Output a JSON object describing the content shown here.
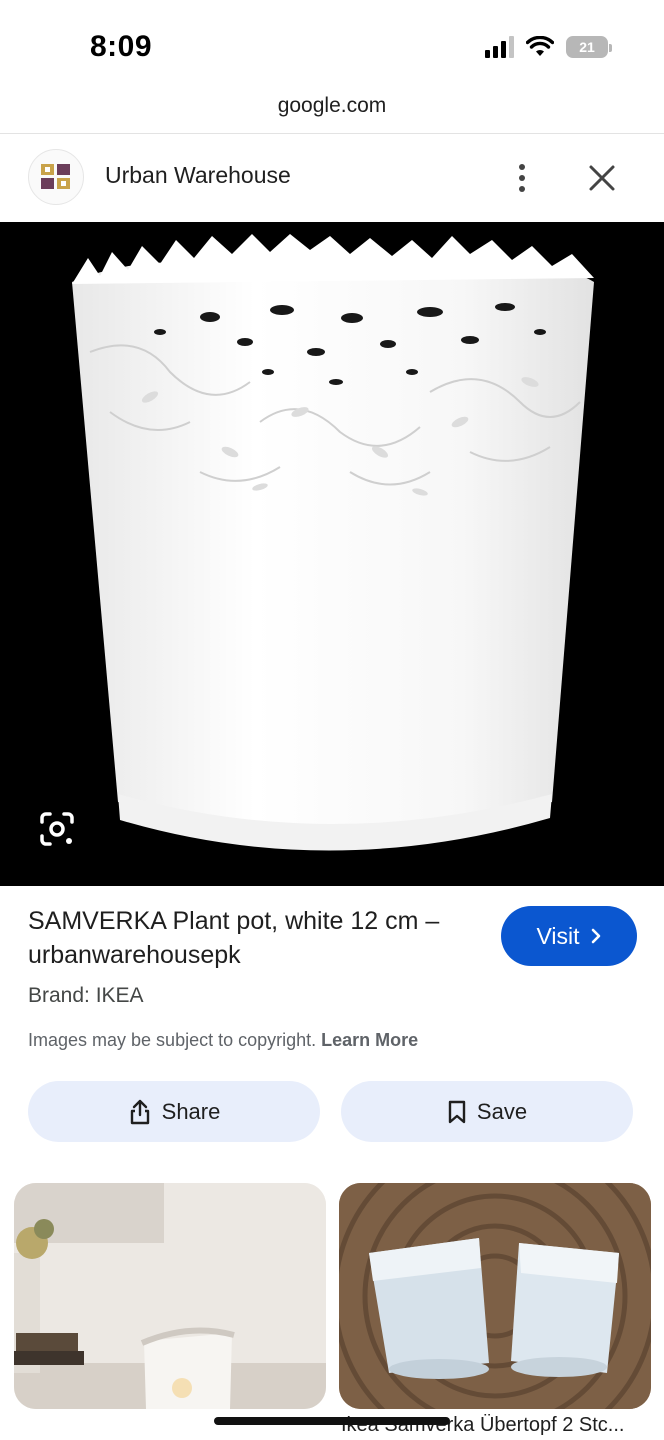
{
  "status_bar": {
    "time": "8:09",
    "battery": "21"
  },
  "browser": {
    "url": "google.com"
  },
  "header": {
    "site_name": "Urban Warehouse"
  },
  "product": {
    "title": "SAMVERKA Plant pot, white 12 cm – urbanwarehousepk",
    "brand": "Brand: IKEA",
    "copyright_text": "Images may be subject to copyright.",
    "learn_more": "Learn More"
  },
  "actions": {
    "visit_label": "Visit",
    "share_label": "Share",
    "save_label": "Save"
  },
  "related": [
    {
      "caption": ""
    },
    {
      "caption": "Ikea Samverka Übertopf 2 Stc..."
    }
  ],
  "icons": {
    "more": "more-vert-icon",
    "close": "close-icon",
    "lens": "google-lens-icon",
    "visit_arrow": "chevron-right-icon",
    "share": "share-icon",
    "save": "bookmark-icon"
  },
  "colors": {
    "accent": "#0b57d0",
    "action_button_bg": "#e8eefb",
    "hero_bg": "#000000"
  }
}
